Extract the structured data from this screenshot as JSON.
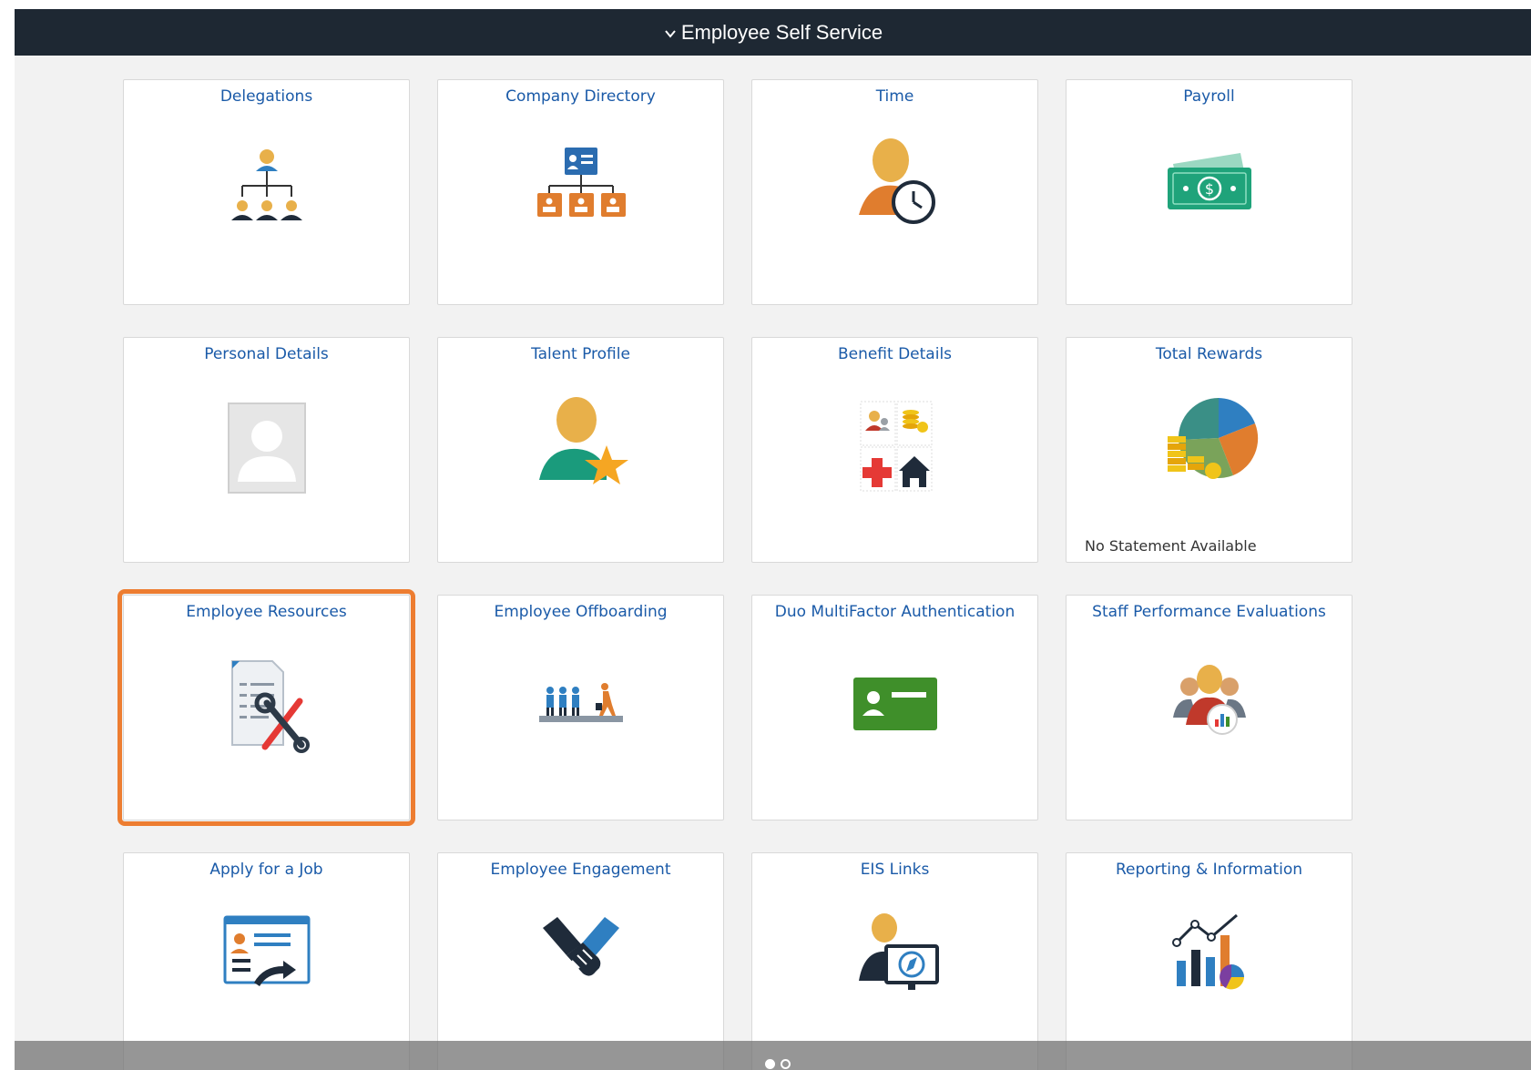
{
  "header": {
    "title": "Employee Self Service",
    "chevron_icon": "chevron-down-icon"
  },
  "tiles": [
    {
      "title": "Delegations",
      "icon": "org-chart-icon"
    },
    {
      "title": "Company Directory",
      "icon": "directory-icon"
    },
    {
      "title": "Time",
      "icon": "person-clock-icon"
    },
    {
      "title": "Payroll",
      "icon": "money-icon"
    },
    {
      "title": "Personal Details",
      "icon": "photo-placeholder-icon"
    },
    {
      "title": "Talent Profile",
      "icon": "person-star-icon"
    },
    {
      "title": "Benefit Details",
      "icon": "benefits-grid-icon"
    },
    {
      "title": "Total Rewards",
      "icon": "rewards-pie-icon",
      "note": "No Statement Available"
    },
    {
      "title": "Employee Resources",
      "icon": "document-tools-icon",
      "selected": true
    },
    {
      "title": "Employee Offboarding",
      "icon": "offboarding-icon"
    },
    {
      "title": "Duo MultiFactor Authentication",
      "icon": "id-card-icon"
    },
    {
      "title": "Staff Performance Evaluations",
      "icon": "team-chart-icon"
    },
    {
      "title": "Apply for a Job",
      "icon": "job-application-icon"
    },
    {
      "title": "Employee Engagement",
      "icon": "handshake-icon"
    },
    {
      "title": "EIS Links",
      "icon": "person-monitor-icon"
    },
    {
      "title": "Reporting & Information",
      "icon": "reporting-chart-icon"
    }
  ],
  "pagination": {
    "pages": 2,
    "current": 1
  },
  "colors": {
    "header_bg": "#1e2833",
    "tile_title": "#1a5aa8",
    "selection": "#ed7d31",
    "page_bg": "#f2f2f2"
  }
}
